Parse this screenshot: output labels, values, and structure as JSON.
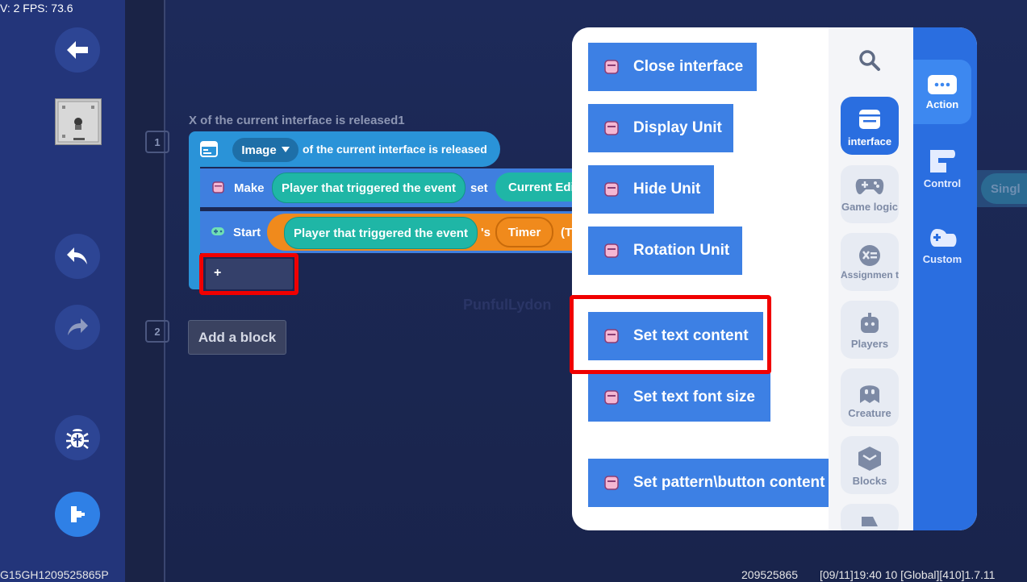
{
  "status": {
    "fps_text": "V: 2 FPS: 73.6",
    "device_id": "G15GH1209525865P",
    "footer_id": "209525865",
    "footer_info": "[09/11]19:40 10  [Global][410]1.7.11"
  },
  "editor": {
    "line_numbers": [
      "1",
      "2"
    ],
    "event_title": "X of the current interface is released1",
    "event": {
      "dropdown_value": "Image",
      "text": "of the current interface is released"
    },
    "make_row": {
      "label": "Make",
      "param1": "Player that triggered the event",
      "set_word": "set",
      "param2": "Current Edit"
    },
    "start_row": {
      "label": "Start",
      "param1": "Player that triggered the event",
      "possessive": "'s",
      "param2": "Timer",
      "trail": "(T"
    },
    "add_slot": "+",
    "add_block": "Add a block",
    "ghost_text": "PunfulLydon",
    "peek_label": "Singl"
  },
  "palette": {
    "blocks": [
      "Close interface",
      "Display Unit",
      "Hide Unit",
      "Rotation Unit",
      "Set text content",
      "Set text font size",
      "Set pattern\\button content"
    ],
    "categories": [
      {
        "label": "interface",
        "icon": "interface-icon",
        "active": true
      },
      {
        "label": "Game logic",
        "icon": "gamepad-icon",
        "active": false
      },
      {
        "label": "Assignmen t",
        "icon": "assignment-icon",
        "active": false
      },
      {
        "label": "Players",
        "icon": "player-icon",
        "active": false
      },
      {
        "label": "Creature",
        "icon": "creature-icon",
        "active": false
      },
      {
        "label": "Blocks",
        "icon": "cube-icon",
        "active": false
      }
    ],
    "tabs": [
      {
        "label": "Action",
        "icon": "action-icon",
        "active": true
      },
      {
        "label": "Control",
        "icon": "control-icon",
        "active": false
      },
      {
        "label": "Custom",
        "icon": "custom-icon",
        "active": false
      }
    ]
  },
  "colors": {
    "block_blue": "#3d80e4",
    "event_cyan": "#2a93d8",
    "param_teal": "#1fb6a6",
    "param_orange": "#f08a1c",
    "highlight_red": "#f00000"
  }
}
